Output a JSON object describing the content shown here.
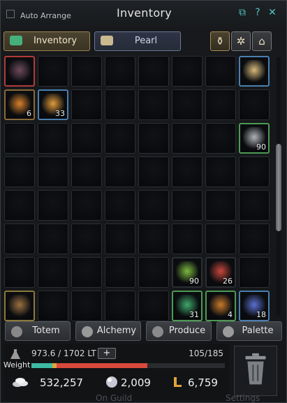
{
  "header": {
    "auto_arrange_label": "Auto Arrange",
    "title": "Inventory",
    "icons": [
      "popout-icon",
      "help-icon",
      "close-icon"
    ],
    "icon_glyphs": [
      "⧉",
      "?",
      "✕"
    ]
  },
  "tabs": [
    {
      "label": "Inventory",
      "active": true
    },
    {
      "label": "Pearl",
      "active": false
    }
  ],
  "sort_buttons": [
    "bag-icon",
    "gear-wheel-icon",
    "house-icon"
  ],
  "sort_glyphs": [
    "⚱",
    "✲",
    "⌂"
  ],
  "grid": {
    "columns": 8,
    "rows": 8,
    "items": [
      {
        "index": 0,
        "name": "book-item",
        "quantity": "",
        "border": "#b33a3a",
        "color": "#6e4a5a"
      },
      {
        "index": 7,
        "name": "scroll-item",
        "quantity": "",
        "border": "#4a7fb0",
        "color": "#d8b97a"
      },
      {
        "index": 8,
        "name": "orange-potion-item",
        "quantity": "6",
        "border": "#8a6a3a",
        "color": "#d8802a"
      },
      {
        "index": 9,
        "name": "orange-elixir-item",
        "quantity": "33",
        "border": "#4a7fb0",
        "color": "#e09a3a"
      },
      {
        "index": 23,
        "name": "key-item",
        "quantity": "90",
        "border": "#4d9a52",
        "color": "#b0b4b8"
      },
      {
        "index": 53,
        "name": "green-herb-item",
        "quantity": "90",
        "border": "#2b2e33",
        "color": "#7ab83e"
      },
      {
        "index": 54,
        "name": "red-herb-item",
        "quantity": "26",
        "border": "#2b2e33",
        "color": "#c8463a"
      },
      {
        "index": 56,
        "name": "anvil-item",
        "quantity": "",
        "border": "#8a7a3a",
        "color": "#9a7040"
      },
      {
        "index": 61,
        "name": "green-sprout-item",
        "quantity": "31",
        "border": "#4d9a52",
        "color": "#3ea86a"
      },
      {
        "index": 62,
        "name": "copper-ring-item",
        "quantity": "4",
        "border": "#4d9a52",
        "color": "#c87a2a"
      },
      {
        "index": 63,
        "name": "blue-shell-item",
        "quantity": "18",
        "border": "#4a7fb0",
        "color": "#5a6fd0"
      }
    ]
  },
  "bottom_buttons": [
    {
      "label": "Totem",
      "icon": "totem-icon"
    },
    {
      "label": "Alchemy",
      "icon": "alchemy-icon"
    },
    {
      "label": "Produce",
      "icon": "produce-icon"
    },
    {
      "label": "Palette",
      "icon": "palette-icon"
    }
  ],
  "weight": {
    "text": "973.6 / 1702 LT",
    "label": "Weight",
    "plus_label": "+",
    "slots_text": "105/185",
    "segments": [
      0.11,
      0.02,
      0.47
    ]
  },
  "currency": [
    {
      "icon": "silver-icon",
      "value": "532,257",
      "color": "#d6d8dc"
    },
    {
      "icon": "pearl-icon",
      "value": "2,009",
      "color": "#e8e8f0"
    },
    {
      "icon": "loyalty-icon",
      "value": "6,759",
      "color": "#e0a43a"
    }
  ],
  "trash": {
    "icon": "trash-icon"
  },
  "footer_ghost": [
    "On Guild",
    "Settings"
  ]
}
